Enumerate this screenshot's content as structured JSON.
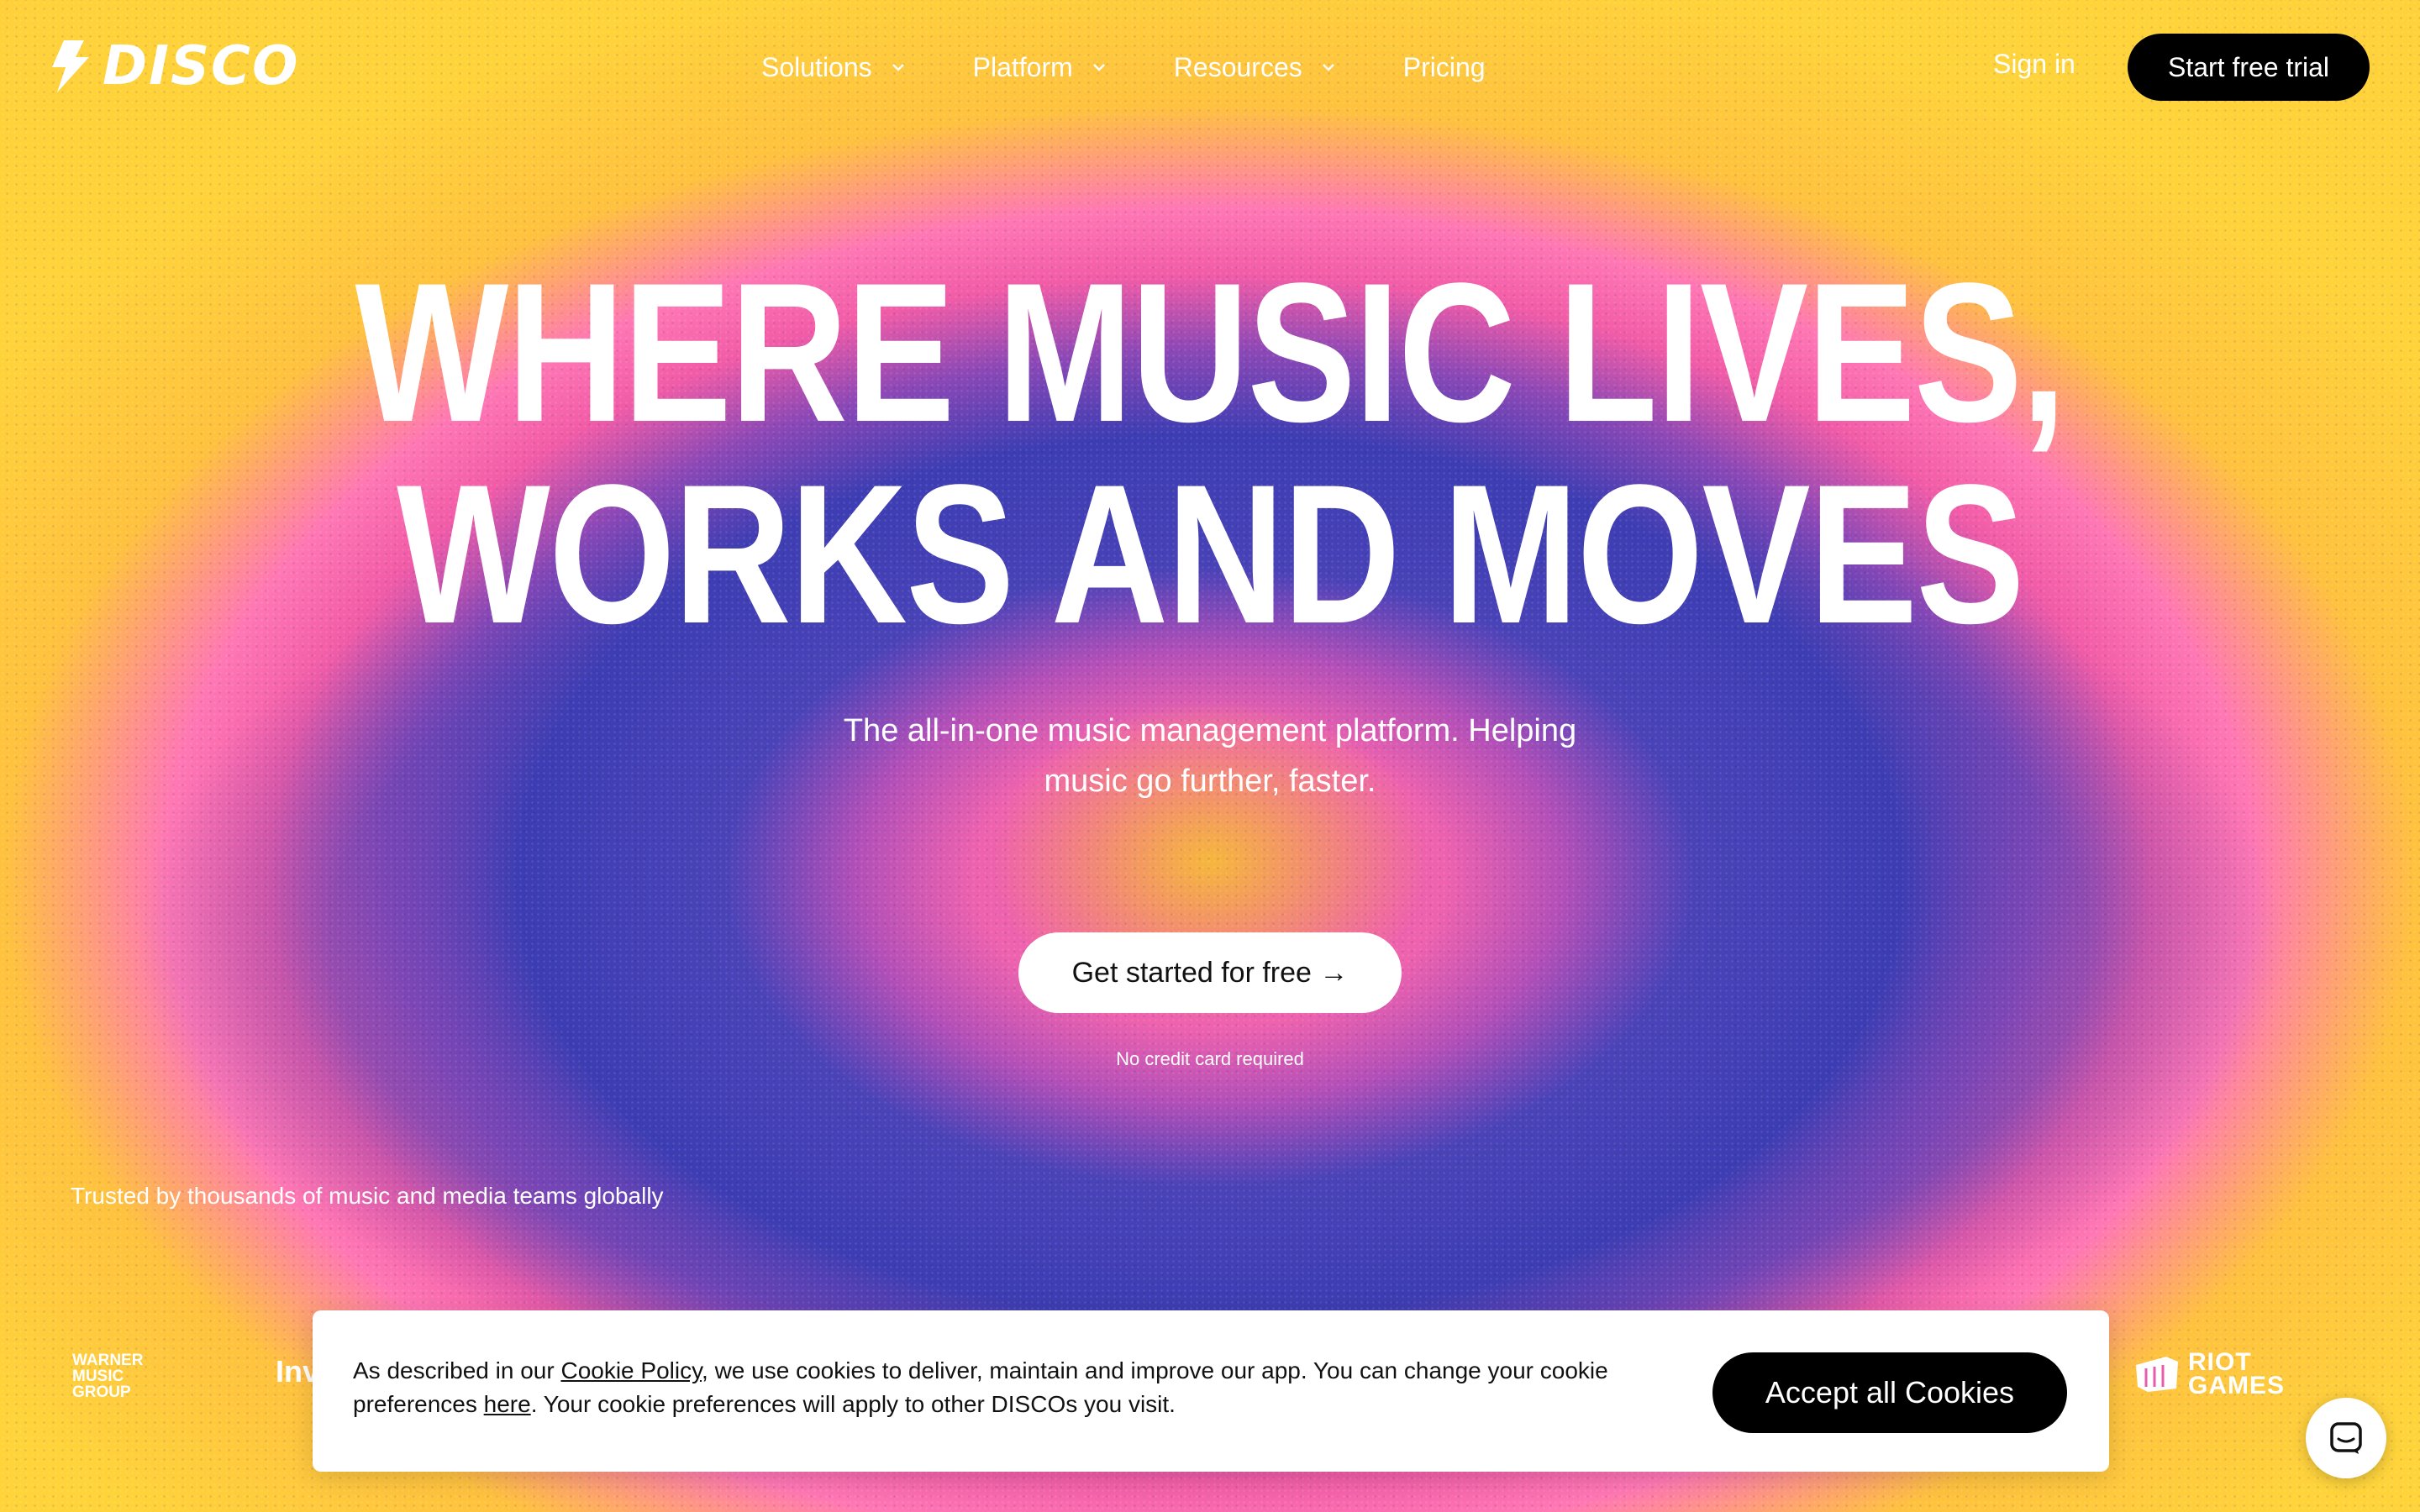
{
  "brand": {
    "name": "DISCO",
    "logo_icon": "lightning-bolt-icon"
  },
  "nav": {
    "items": [
      {
        "label": "Solutions",
        "has_dropdown": true
      },
      {
        "label": "Platform",
        "has_dropdown": true
      },
      {
        "label": "Resources",
        "has_dropdown": true
      },
      {
        "label": "Pricing",
        "has_dropdown": false
      }
    ],
    "sign_in": "Sign in",
    "trial_button": "Start free trial"
  },
  "hero": {
    "title_line1": "WHERE MUSIC LIVES,",
    "title_line2": "WORKS AND MOVES",
    "subtitle": "The all-in-one music management platform. Helping music go further, faster.",
    "cta": "Get started for free →",
    "cta_note": "No credit card required"
  },
  "trusted": {
    "text": "Trusted by thousands of music and media teams globally",
    "logos": {
      "warner": [
        "WARNER",
        "MUSIC",
        "GROUP"
      ],
      "partial": "Inv",
      "riot": [
        "RIOT",
        "GAMES"
      ]
    }
  },
  "cookie": {
    "text_before": "As described in our ",
    "policy_link": "Cookie Policy",
    "text_middle": ", we use cookies to deliver, maintain and improve our app. You can change your cookie preferences ",
    "here_link": "here",
    "text_after": ". Your cookie preferences will apply to other DISCOs you visit.",
    "accept_button": "Accept all Cookies"
  },
  "chat": {
    "icon": "chat-icon"
  },
  "colors": {
    "yellow": "#ffd43a",
    "pink": "#f25ca7",
    "blue": "#3d3db3",
    "button_dark": "#000000",
    "white": "#ffffff"
  }
}
